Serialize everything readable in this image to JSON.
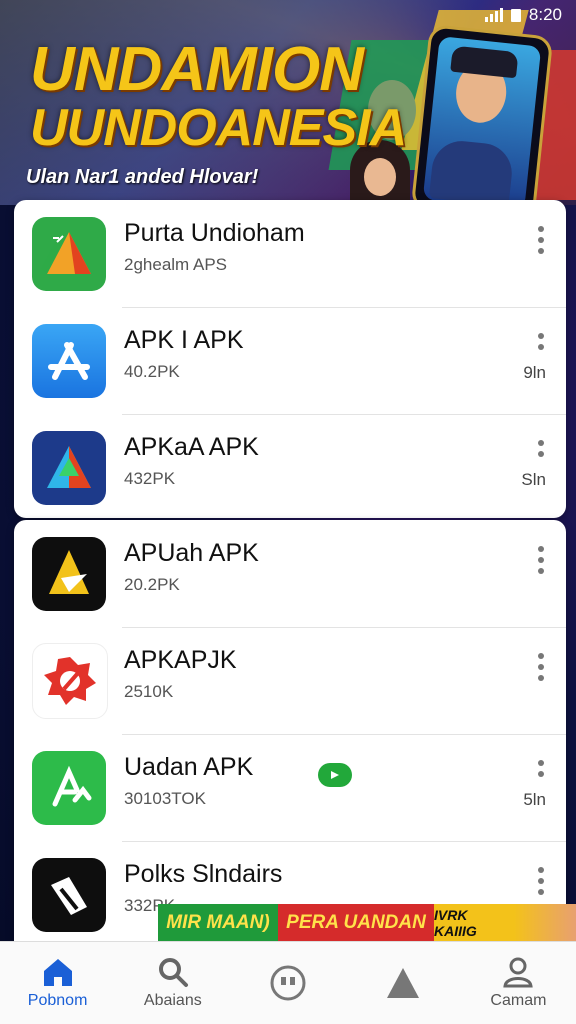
{
  "status": {
    "time": "8:20"
  },
  "banner": {
    "title_line1": "UNDAMION",
    "title_line2": "UUNDOANESIA",
    "tagline": "Ulan Nar1 anded Hlovar!"
  },
  "apps_top": [
    {
      "name": "Purta Undioham",
      "sub": "2ghealm APS",
      "size": ""
    },
    {
      "name": "APK I APK",
      "sub": "40.2PK",
      "size": "9ln"
    },
    {
      "name": "APKaA APK",
      "sub": "432PK",
      "size": "Sln"
    }
  ],
  "apps_bottom": [
    {
      "name": "APUah APK",
      "sub": "20.2PK",
      "size": ""
    },
    {
      "name": "APKAPJK",
      "sub": "2510K",
      "size": ""
    },
    {
      "name": "Uadan APK",
      "sub": "30103TOK",
      "size": "5ln"
    },
    {
      "name": "Polks Slndairs",
      "sub": "332PK",
      "size": ""
    }
  ],
  "promo": {
    "green": "MIR MAAN)",
    "red": "PERA UANDAN",
    "badge": "IVRK KAIIIG"
  },
  "nav": [
    {
      "label": "Pobnom",
      "icon": "home-icon"
    },
    {
      "label": "Abaians",
      "icon": "search-icon"
    },
    {
      "label": "",
      "icon": "chat-icon"
    },
    {
      "label": "",
      "icon": "triangle-icon"
    },
    {
      "label": "Camam",
      "icon": "user-icon"
    }
  ],
  "colors": {
    "accent": "#1a5fd6",
    "title_gold": "#f5c518"
  }
}
